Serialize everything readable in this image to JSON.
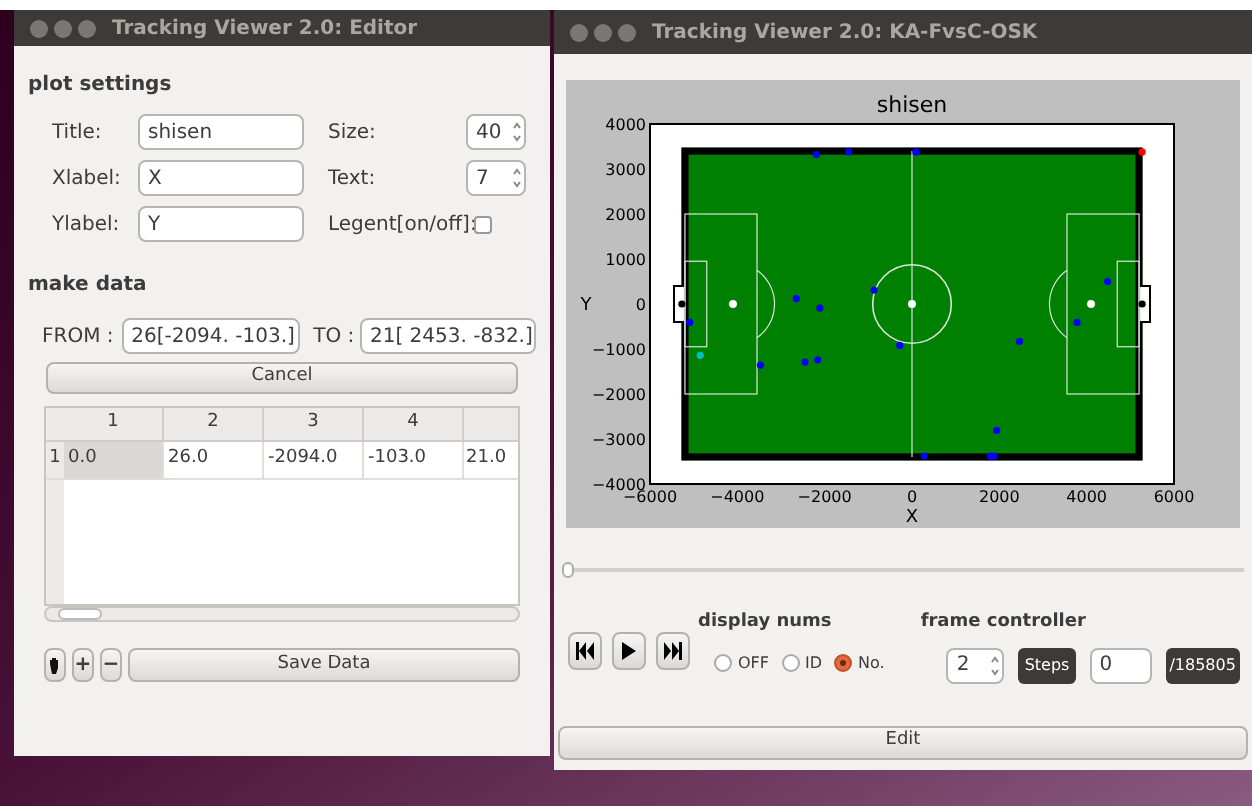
{
  "editor_window": {
    "title": "Tracking Viewer 2.0: Editor",
    "plot_settings": {
      "heading": "plot settings",
      "fields": [
        {
          "label": "Title:",
          "value": "shisen"
        },
        {
          "label": "Xlabel:",
          "value": "X"
        },
        {
          "label": "Ylabel:",
          "value": "Y"
        }
      ],
      "size": {
        "label": "Size:",
        "value": "40"
      },
      "text": {
        "label": "Text:",
        "value": "7"
      },
      "legend": {
        "label": "Legent[on/off]:",
        "checked": false
      }
    },
    "make_data": {
      "heading": "make data",
      "from": {
        "label": "FROM :",
        "value": "26[-2094. -103.]"
      },
      "to": {
        "label": "TO :",
        "value": "21[ 2453. -832.]"
      },
      "cancel_button": "Cancel"
    },
    "table": {
      "columns": [
        "1",
        "2",
        "3",
        "4"
      ],
      "rows": [
        {
          "header": "1",
          "cells": [
            {
              "text": "0.0",
              "selected": true
            },
            {
              "text": "26.0",
              "selected": false
            },
            {
              "text": "-2094.0",
              "selected": false
            },
            {
              "text": "-103.0",
              "selected": false
            },
            {
              "text": "21.0",
              "selected": false
            }
          ]
        }
      ]
    },
    "buttons": [
      "+",
      "−"
    ],
    "save_button": "Save Data"
  },
  "viewer_window": {
    "title": "Tracking Viewer 2.0: KA-FvsC-OSK",
    "chart_data": {
      "type": "scatter",
      "title": "shisen",
      "xlabel": "X",
      "ylabel": "Y",
      "xlim": [
        -6000,
        6000
      ],
      "ylim": [
        -4000,
        4000
      ],
      "xticks": [
        {
          "value": -6000,
          "label": "−6000"
        },
        {
          "value": -4000,
          "label": "−4000"
        },
        {
          "value": -2000,
          "label": "−2000"
        },
        {
          "value": 0,
          "label": "0"
        },
        {
          "value": 2000,
          "label": "2000"
        },
        {
          "value": 4000,
          "label": "4000"
        },
        {
          "value": 6000,
          "label": "6000"
        }
      ],
      "yticks": [
        {
          "value": -4000,
          "label": "−4000"
        },
        {
          "value": -3000,
          "label": "−3000"
        },
        {
          "value": -2000,
          "label": "−2000"
        },
        {
          "value": -1000,
          "label": "−1000"
        },
        {
          "value": 0,
          "label": "0"
        },
        {
          "value": 1000,
          "label": "1000"
        },
        {
          "value": 2000,
          "label": "2000"
        },
        {
          "value": 3000,
          "label": "3000"
        },
        {
          "value": 4000,
          "label": "4000"
        }
      ],
      "x": [
        -5270,
        -5090,
        -4850,
        -3470,
        -2650,
        -2450,
        -2190,
        -2160,
        -2110,
        -1450,
        -870,
        -280,
        90,
        280,
        1790,
        1880,
        1940,
        2460,
        3780,
        4480,
        5270,
        5270
      ],
      "series": [
        {
          "color": "#0000ff",
          "values": [
            null,
            -410,
            null,
            -1360,
            120,
            -1290,
            3320,
            -1240,
            -90,
            3380,
            310,
            -920,
            3380,
            -3380,
            -3380,
            -3380,
            -2810,
            -830,
            -410,
            500,
            null,
            null
          ]
        },
        {
          "color": "#000000",
          "values": [
            0,
            null,
            null,
            null,
            null,
            null,
            null,
            null,
            null,
            null,
            null,
            null,
            null,
            null,
            null,
            null,
            null,
            null,
            null,
            null,
            0,
            null
          ]
        },
        {
          "color": "#ff0000",
          "values": [
            null,
            null,
            null,
            null,
            null,
            null,
            null,
            null,
            null,
            null,
            null,
            null,
            null,
            null,
            null,
            null,
            null,
            null,
            null,
            null,
            null,
            3380
          ]
        },
        {
          "color": "#00bfbf",
          "values": [
            null,
            null,
            -1140,
            null,
            null,
            null,
            null,
            null,
            null,
            null,
            null,
            null,
            null,
            null,
            null,
            null,
            null,
            null,
            null,
            null,
            null,
            null
          ]
        }
      ]
    },
    "slider": {
      "level": 0
    },
    "display_nums": {
      "label": "display nums",
      "options": [
        {
          "label": "OFF",
          "selected": false
        },
        {
          "label": "ID",
          "selected": false
        },
        {
          "label": "No.",
          "selected": true
        }
      ]
    },
    "frame_controller": {
      "label": "frame controller",
      "step": "2",
      "steps_button": "Steps",
      "frame": "0",
      "total": "/185805"
    },
    "edit_button": "Edit"
  }
}
